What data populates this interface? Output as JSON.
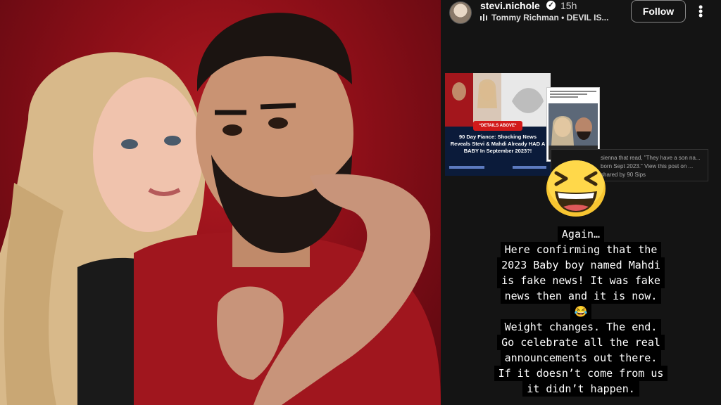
{
  "story": {
    "username": "stevi.nichole",
    "verified_icon": "verified-badge-icon",
    "time": "15h",
    "music": "Tommy Richman • DEVIL IS...",
    "follow_label": "Follow",
    "more_icon": "more-vertical-icon",
    "music_icon": "music-bars-icon",
    "shared_post": {
      "tag": "*DETAILS ABOVE*",
      "headline": "90 Day Fiance: Shocking News Reveals Stevi & Mahdi Already HAD A BABY In September 2023?!",
      "caption": "sienna that read, \"They have a son na... born Sept 2023.\" View this post on ... shared by 90 Sips"
    },
    "emoji_icon": "grinning-squinting-face-icon",
    "text_lines": [
      "Again…",
      "Here confirming that the",
      "2023 Baby boy named Mahdi",
      "is fake news! It was fake",
      "news then and it is now.",
      "😂",
      "Weight changes. The end.",
      "Go celebrate all the real",
      "announcements out there.",
      "If it doesn’t come from us",
      "it didn’t happen."
    ]
  },
  "colors": {
    "photo_background": "#8d0f18",
    "story_background": "#141414",
    "text_background": "#000000"
  }
}
